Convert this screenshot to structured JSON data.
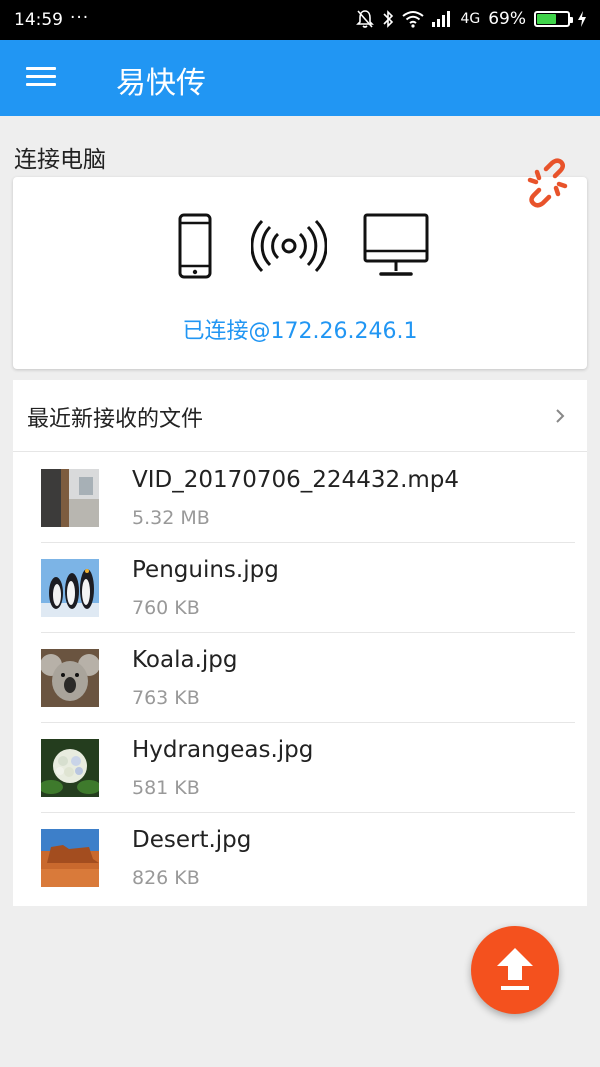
{
  "status_bar": {
    "time": "14:59",
    "dots": "···",
    "network": "4G",
    "battery_pct": "69%",
    "battery_level": 0.69
  },
  "app_bar": {
    "title": "易快传"
  },
  "connect": {
    "section_label": "连接电脑",
    "status": "已连接@172.26.246.1",
    "icons": [
      "phone-icon",
      "signal-icon",
      "monitor-icon",
      "unlink-icon"
    ]
  },
  "recent": {
    "title": "最近新接收的文件",
    "files": [
      {
        "name": "VID_20170706_224432.mp4",
        "size": "5.32 MB"
      },
      {
        "name": "Penguins.jpg",
        "size": "760 KB"
      },
      {
        "name": "Koala.jpg",
        "size": "763 KB"
      },
      {
        "name": "Hydrangeas.jpg",
        "size": "581 KB"
      },
      {
        "name": "Desert.jpg",
        "size": "826 KB"
      }
    ]
  },
  "colors": {
    "primary": "#2196f3",
    "accent": "#f4511e",
    "unlink": "#e8532b"
  }
}
